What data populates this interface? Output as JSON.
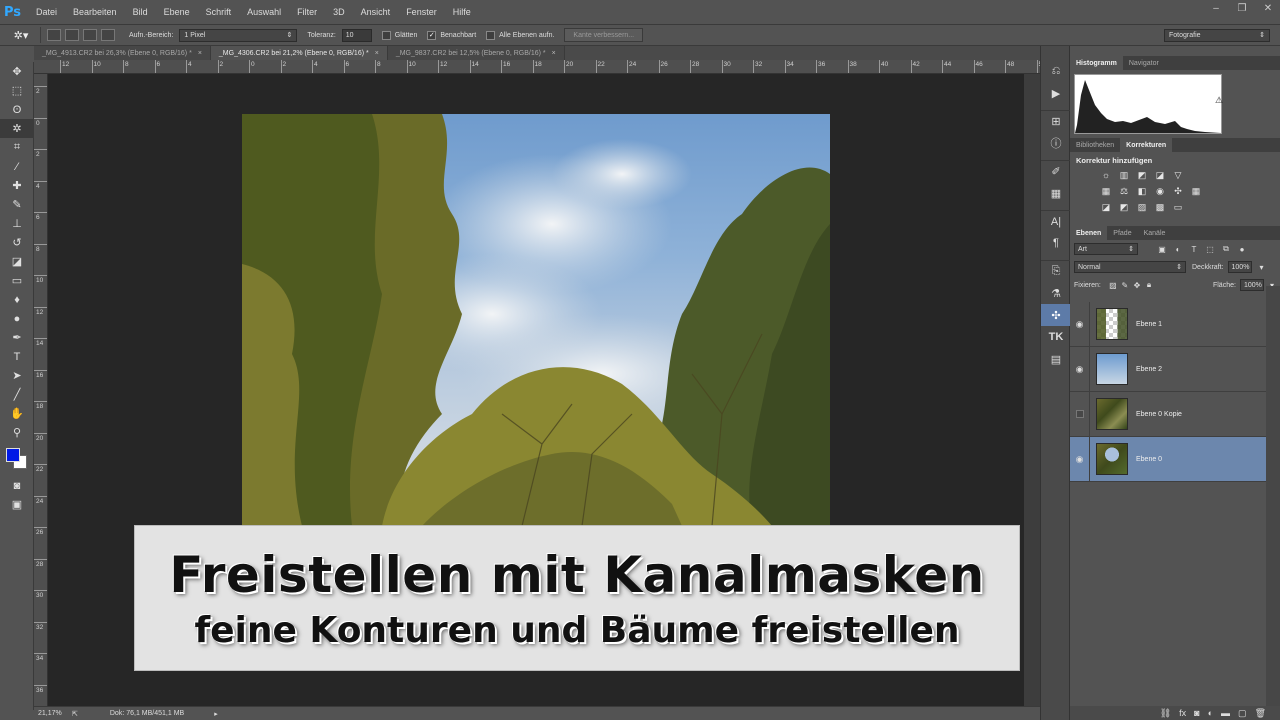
{
  "app": {
    "logo": "Ps"
  },
  "menu": [
    "Datei",
    "Bearbeiten",
    "Bild",
    "Ebene",
    "Schrift",
    "Auswahl",
    "Filter",
    "3D",
    "Ansicht",
    "Fenster",
    "Hilfe"
  ],
  "window_controls": [
    "–",
    "❐",
    "✕"
  ],
  "options": {
    "sample_size_label": "Aufn.-Bereich:",
    "sample_size_value": "1 Pixel",
    "tolerance_label": "Toleranz:",
    "tolerance_value": "10",
    "antialias_label": "Glätten",
    "contiguous_label": "Benachbart",
    "sample_all_label": "Alle Ebenen aufn.",
    "refine_edge": "Kante verbessern...",
    "workspace": "Fotografie"
  },
  "doc_tabs": [
    {
      "label": "_MG_4913.CR2 bei 26,3% (Ebene 0, RGB/16) *",
      "active": false
    },
    {
      "label": "_MG_4306.CR2 bei 21,2% (Ebene 0, RGB/16) *",
      "active": true
    },
    {
      "label": "_MG_9837.CR2 bei 12,5% (Ebene 0, RGB/16) *",
      "active": false
    }
  ],
  "ruler_h": [
    "12",
    "10",
    "8",
    "6",
    "4",
    "2",
    "0",
    "2",
    "4",
    "6",
    "8",
    "10",
    "12",
    "14",
    "16",
    "18",
    "20",
    "22",
    "24",
    "26",
    "28",
    "30",
    "32",
    "34",
    "36",
    "38",
    "40",
    "42",
    "44",
    "46",
    "48",
    "50"
  ],
  "ruler_v": [
    "2",
    "0",
    "2",
    "4",
    "6",
    "8",
    "10",
    "12",
    "14",
    "16",
    "18",
    "20",
    "22",
    "24",
    "26",
    "28",
    "30",
    "32",
    "34",
    "36"
  ],
  "title": {
    "main": "Freistellen mit Kanalmasken",
    "sub": "feine Konturen und Bäume freistellen"
  },
  "status": {
    "zoom": "21,17%",
    "doc": "Dok: 76,1 MB/451,1 MB"
  },
  "panels": {
    "hist_tabs": [
      "Histogramm",
      "Navigator"
    ],
    "adj_tabs": [
      "Bibliotheken",
      "Korrekturen"
    ],
    "adj_title": "Korrektur hinzufügen",
    "layer_tabs": [
      "Ebenen",
      "Pfade",
      "Kanäle"
    ],
    "filter_kind": "Art",
    "blend_mode": "Normal",
    "opacity_label": "Deckkraft:",
    "opacity_value": "100%",
    "lock_label": "Fixieren:",
    "fill_label": "Fläche:",
    "fill_value": "100%"
  },
  "layers": [
    {
      "name": "Ebene 1",
      "visible": true,
      "thumb": "checker",
      "selected": false
    },
    {
      "name": "Ebene 2",
      "visible": true,
      "thumb": "sky",
      "selected": false
    },
    {
      "name": "Ebene 0 Kopie",
      "visible": false,
      "thumb": "trees",
      "selected": false
    },
    {
      "name": "Ebene 0",
      "visible": true,
      "thumb": "full",
      "selected": true
    }
  ],
  "colors": {
    "foreground": "#0019e6",
    "background": "#ffffff",
    "selection": "#6c87ad"
  }
}
